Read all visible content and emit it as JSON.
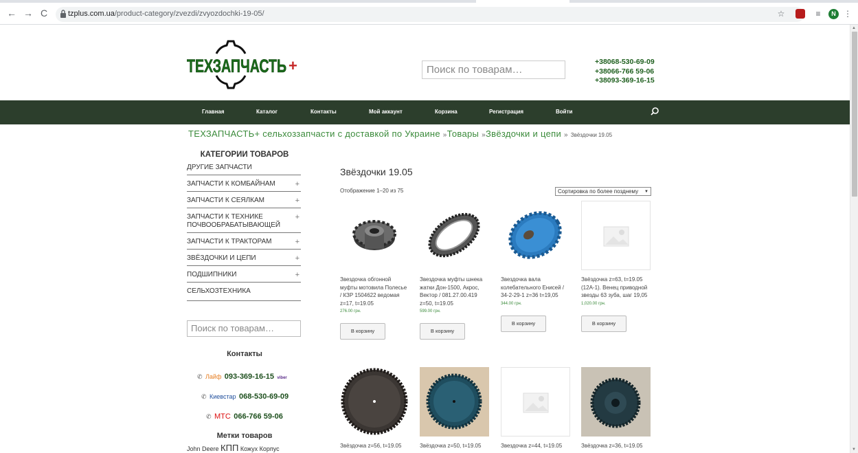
{
  "browser": {
    "url_host": "tzplus.com.ua",
    "url_path": "/product-category/zvezdi/zvyozdochki-19-05/",
    "profile_initial": "N"
  },
  "header": {
    "logo_text": "ТЕХЗАПЧАСТЬ +",
    "search_placeholder": "Поиск по товарам…",
    "phones": [
      "+38068-530-69-09",
      "+38066-766 59-06",
      "+38093-369-16-15"
    ]
  },
  "nav": {
    "items": [
      "Главная",
      "Каталог",
      "Контакты",
      "Мой аккаунт",
      "Корзина",
      "Регистрация",
      "Войти"
    ]
  },
  "breadcrumb": {
    "home": "ТЕХЗАПЧАСТЬ+ сельхоззапчасти с доставкой по Украине",
    "sep": "»",
    "level1": "Товары",
    "level2": "Звёздочки и цепи",
    "current": "Звёздочки 19.05"
  },
  "sidebar": {
    "title": "КАТЕГОРИИ ТОВАРОВ",
    "categories": [
      {
        "label": "ДРУГИЕ ЗАПЧАСТИ",
        "expand": ""
      },
      {
        "label": "ЗАПЧАСТИ К КОМБАЙНАМ",
        "expand": "+"
      },
      {
        "label": "ЗАПЧАСТИ К СЕЯЛКАМ",
        "expand": "+"
      },
      {
        "label": "ЗАПЧАСТИ К ТЕХНИКЕ ПОЧВООБРАБАТЫВАЮЩЕЙ",
        "expand": "+"
      },
      {
        "label": "ЗАПЧАСТИ К ТРАКТОРАМ",
        "expand": "+"
      },
      {
        "label": "ЗВЁЗДОЧКИ И ЦЕПИ",
        "expand": "+"
      },
      {
        "label": "ПОДШИПНИКИ",
        "expand": "+"
      },
      {
        "label": "СЕЛЬХОЗТЕХНИКА",
        "expand": ""
      }
    ],
    "search_placeholder": "Поиск по товарам…",
    "contacts_title": "Контакты",
    "contacts": [
      {
        "operator": "Лайф",
        "number": "093-369-16-15",
        "extra": "viber"
      },
      {
        "operator": "Киевстар",
        "number": "068-530-69-09",
        "extra": ""
      },
      {
        "operator": "МТС",
        "number": "066-766 59-06",
        "extra": ""
      }
    ],
    "tags_title": "Метки товаров",
    "tags": [
      "John Deere",
      "КПП",
      "Кожух",
      "Корпус"
    ]
  },
  "main": {
    "title": "Звёздочки 19.05",
    "result_count": "Отображение 1–20 из 75",
    "orderby": "Сортировка по более позднему",
    "add_to_cart": "В корзину",
    "products": [
      {
        "name": "Звездочка обгонной муфты мотовила Полесье / КЗР 1504622 ведомая z=17, t=19.05",
        "price": "276.00 грн."
      },
      {
        "name": "Звездочка муфты шнека жатки Дон-1500, Акрос, Вектор / 081.27.00.419 z=50, t=19.05",
        "price": "599.00 грн."
      },
      {
        "name": "Звездочка вала колебательного Енисей / 34-2-29-1 z=36 t=19,05",
        "price": "344.00 грн."
      },
      {
        "name": "Звёздочка z=63, t=19.05 (12А-1). Венец приводной звезды 63 зуба, шаг 19,05",
        "price": "1,020.00 грн."
      },
      {
        "name": "Звёздочка z=56, t=19.05",
        "price": ""
      },
      {
        "name": "Звёздочка z=50, t=19.05",
        "price": ""
      },
      {
        "name": "Звездочка z=44, t=19.05",
        "price": ""
      },
      {
        "name": "Звёздочка z=36, t=19.05",
        "price": ""
      }
    ]
  },
  "colors": {
    "nav_bg": "#2c3e2c",
    "brand_green": "#3a8a3a",
    "phone_green": "#1e5f1e",
    "life_orange": "#e67e22",
    "kyivstar_blue": "#1f4e9c",
    "mts_red": "#d11"
  }
}
